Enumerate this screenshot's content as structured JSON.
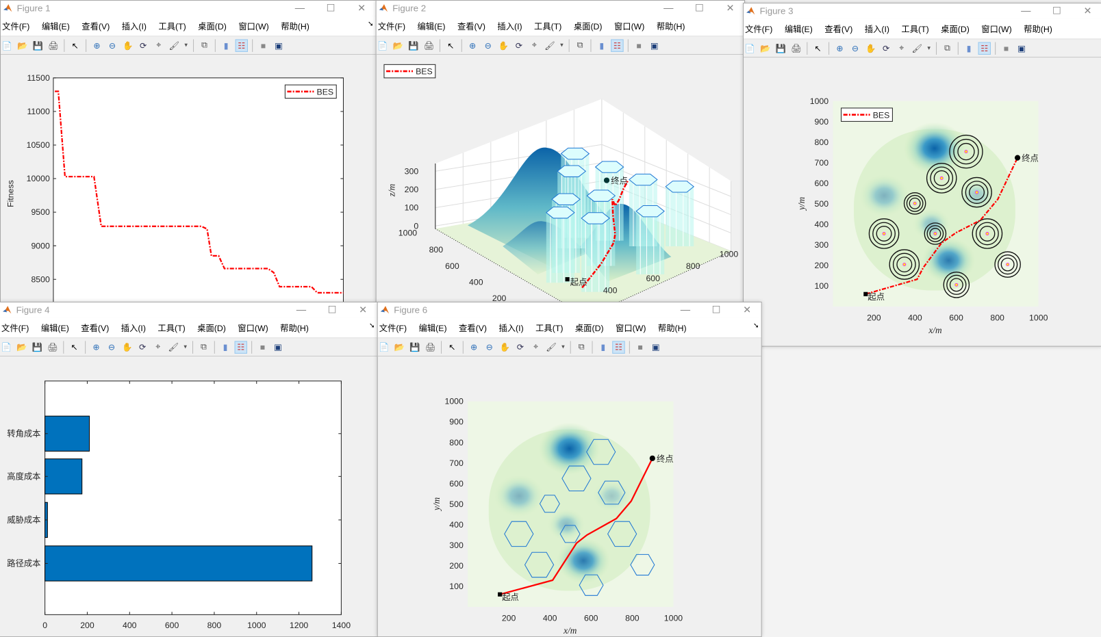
{
  "menu": [
    "文件(F)",
    "编辑(E)",
    "查看(V)",
    "插入(I)",
    "工具(T)",
    "桌面(D)",
    "窗口(W)",
    "帮助(H)"
  ],
  "toolbar_icons": [
    "new-file-icon",
    "open-file-icon",
    "save-icon",
    "print-icon",
    "|",
    "pointer-icon",
    "|",
    "zoom-in-icon",
    "zoom-out-icon",
    "pan-icon",
    "rotate-3d-icon",
    "data-cursor-icon",
    "brush-icon",
    "dropdown-arrow-icon",
    "|",
    "link-plot-icon",
    "|",
    "colorbar-icon",
    "legend-icon",
    "|",
    "hide-plot-tools-icon",
    "show-plot-tools-icon"
  ],
  "colors": {
    "path": "#ff0000",
    "bar": "#0072bd",
    "hex": "#1f77d4",
    "blue_dark": "#0b63a8",
    "terrain_light": "#eef7e6"
  },
  "windows": {
    "fig1": {
      "title": "Figure 1"
    },
    "fig2": {
      "title": "Figure 2"
    },
    "fig3": {
      "title": "Figure 3"
    },
    "fig4": {
      "title": "Figure 4"
    },
    "fig6": {
      "title": "Figure 6"
    }
  },
  "labels": {
    "start": "起点",
    "end": "终点",
    "legend": "BES",
    "xlabel": "x/m",
    "ylabel": "y/m",
    "zlabel": "z/m",
    "fitness": "Fitness"
  },
  "chart_data": [
    {
      "id": "fig1",
      "type": "line",
      "ylabel": "Fitness",
      "legend": "BES",
      "legend_position": "top-right",
      "ylim": [
        8200,
        11500
      ],
      "yticks": [
        11500,
        11000,
        10500,
        10000,
        9500,
        9000,
        8500
      ],
      "xlim": [
        0,
        100
      ],
      "x": [
        0.5,
        1.7,
        4,
        14,
        16.5,
        51,
        53,
        54.5,
        57,
        59,
        74,
        76,
        78,
        89,
        91,
        100
      ],
      "y": [
        11300,
        11300,
        10030,
        10030,
        9290,
        9290,
        9250,
        8850,
        8850,
        8660,
        8660,
        8600,
        8390,
        8390,
        8300,
        8300
      ]
    },
    {
      "id": "fig2",
      "type": "surface3d",
      "zlabel": "z/m",
      "legend": "BES",
      "legend_position": "top-left",
      "zticks": [
        0,
        100,
        200,
        300
      ],
      "yticks": [
        1000,
        800,
        600,
        400,
        200
      ],
      "xticks": [
        400,
        600,
        800,
        1000
      ]
    },
    {
      "id": "fig3",
      "type": "contour",
      "xlabel": "x/m",
      "ylabel": "y/m",
      "legend": "BES",
      "legend_position": "top-left",
      "xlim": [
        0,
        1000
      ],
      "ylim": [
        0,
        1000
      ],
      "xticks": [
        200,
        400,
        600,
        800,
        1000
      ],
      "yticks": [
        100,
        200,
        300,
        400,
        500,
        600,
        700,
        800,
        900,
        1000
      ],
      "path": [
        [
          160,
          61
        ],
        [
          410,
          133
        ],
        [
          440,
          190
        ],
        [
          529,
          310
        ],
        [
          600,
          360
        ],
        [
          717,
          420
        ],
        [
          802,
          522
        ],
        [
          898,
          724
        ]
      ],
      "threats": [
        [
          648,
          754,
          80
        ],
        [
          529,
          625,
          72
        ],
        [
          700,
          556,
          72
        ],
        [
          399,
          502,
          52
        ],
        [
          249,
          355,
          72
        ],
        [
          498,
          355,
          52
        ],
        [
          751,
          355,
          72
        ],
        [
          348,
          205,
          72
        ],
        [
          850,
          205,
          62
        ],
        [
          601,
          106,
          62
        ]
      ]
    },
    {
      "id": "fig4",
      "type": "bar",
      "orientation": "horizontal",
      "categories": [
        "转角成本",
        "高度成本",
        "威胁成本",
        "路径成本"
      ],
      "values": [
        210,
        175,
        12,
        1262
      ],
      "xlim": [
        0,
        1400
      ],
      "xticks": [
        0,
        200,
        400,
        600,
        800,
        1000,
        1200,
        1400
      ]
    },
    {
      "id": "fig6",
      "type": "contour",
      "xlabel": "x/m",
      "ylabel": "y/m",
      "xlim": [
        0,
        1000
      ],
      "ylim": [
        0,
        1000
      ],
      "xticks": [
        200,
        400,
        600,
        800,
        1000
      ],
      "yticks": [
        100,
        200,
        300,
        400,
        500,
        600,
        700,
        800,
        900,
        1000
      ],
      "path": [
        [
          157,
          61
        ],
        [
          413,
          130
        ],
        [
          529,
          310
        ],
        [
          580,
          350
        ],
        [
          723,
          430
        ],
        [
          795,
          515
        ],
        [
          898,
          723
        ]
      ],
      "hexagons": [
        [
          648,
          754,
          70
        ],
        [
          529,
          625,
          70
        ],
        [
          700,
          556,
          65
        ],
        [
          399,
          502,
          48
        ],
        [
          249,
          355,
          70
        ],
        [
          498,
          355,
          48
        ],
        [
          751,
          355,
          70
        ],
        [
          348,
          205,
          70
        ],
        [
          850,
          205,
          58
        ],
        [
          601,
          106,
          58
        ]
      ]
    }
  ],
  "terrain_peaks": [
    [
      495,
      770,
      150,
      1
    ],
    [
      563,
      225,
      130,
      0.85
    ],
    [
      250,
      540,
      120,
      0.45
    ],
    [
      480,
      400,
      90,
      0.4
    ],
    [
      700,
      540,
      90,
      0.3
    ]
  ]
}
